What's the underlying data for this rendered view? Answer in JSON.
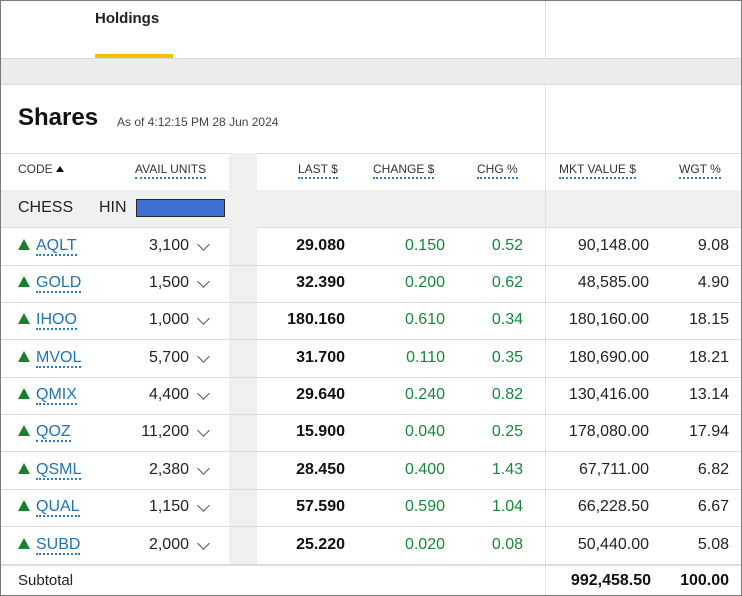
{
  "tabs": [
    {
      "label": "Holdings",
      "active": true
    }
  ],
  "section": {
    "title": "Shares",
    "as_of": "As of 4:12:15 PM  28 Jun 2024"
  },
  "columns": {
    "code": "CODE",
    "avail_units": "AVAIL UNITS",
    "last": "LAST $",
    "change": "CHANGE $",
    "chg_pct": "CHG %",
    "mkt_value": "MKT VALUE $",
    "wgt": "WGT %"
  },
  "chess_row": {
    "chess": "CHESS",
    "hin": "HIN"
  },
  "rows": [
    {
      "code": "AQLT",
      "units": "3,100",
      "last": "29.080",
      "change": "0.150",
      "chg": "0.52",
      "mv": "90,148.00",
      "wgt": "9.08"
    },
    {
      "code": "GOLD",
      "units": "1,500",
      "last": "32.390",
      "change": "0.200",
      "chg": "0.62",
      "mv": "48,585.00",
      "wgt": "4.90"
    },
    {
      "code": "IHOO",
      "units": "1,000",
      "last": "180.160",
      "change": "0.610",
      "chg": "0.34",
      "mv": "180,160.00",
      "wgt": "18.15"
    },
    {
      "code": "MVOL",
      "units": "5,700",
      "last": "31.700",
      "change": "0.110",
      "chg": "0.35",
      "mv": "180,690.00",
      "wgt": "18.21"
    },
    {
      "code": "QMIX",
      "units": "4,400",
      "last": "29.640",
      "change": "0.240",
      "chg": "0.82",
      "mv": "130,416.00",
      "wgt": "13.14"
    },
    {
      "code": "QOZ",
      "units": "11,200",
      "last": "15.900",
      "change": "0.040",
      "chg": "0.25",
      "mv": "178,080.00",
      "wgt": "17.94"
    },
    {
      "code": "QSML",
      "units": "2,380",
      "last": "28.450",
      "change": "0.400",
      "chg": "1.43",
      "mv": "67,711.00",
      "wgt": "6.82"
    },
    {
      "code": "QUAL",
      "units": "1,150",
      "last": "57.590",
      "change": "0.590",
      "chg": "1.04",
      "mv": "66,228.50",
      "wgt": "6.67"
    },
    {
      "code": "SUBD",
      "units": "2,000",
      "last": "25.220",
      "change": "0.020",
      "chg": "0.08",
      "mv": "50,440.00",
      "wgt": "5.08"
    }
  ],
  "subtotal": {
    "label": "Subtotal",
    "mv": "992,458.50",
    "wgt": "100.00"
  },
  "colors": {
    "accent": "#f2c200",
    "positive": "#15883a",
    "link": "#1f73b7",
    "hin_fill": "#3f6fd0"
  },
  "icons": {
    "up": "triangle-up-icon",
    "expand": "chevron-down-icon",
    "sort": "sort-ascending-icon"
  }
}
